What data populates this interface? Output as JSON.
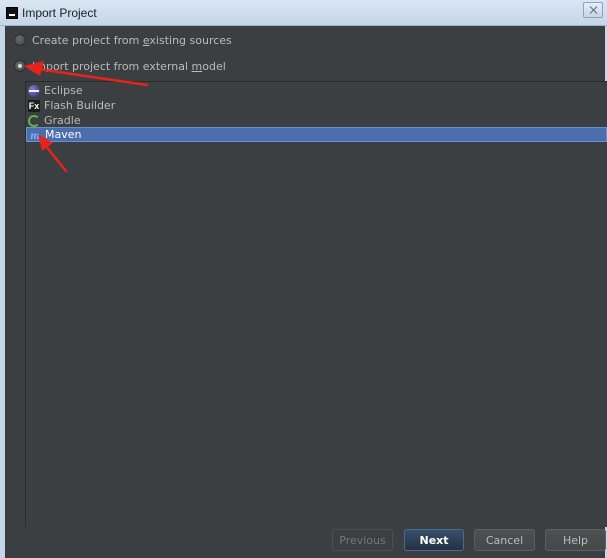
{
  "window": {
    "title": "Import Project"
  },
  "options": {
    "create": {
      "label_pre": "Create project from ",
      "label_mnemonic": "e",
      "label_post": "xisting sources",
      "selected": false
    },
    "import": {
      "label_pre": "Import project from external ",
      "label_mnemonic": "m",
      "label_post": "odel",
      "selected": true
    }
  },
  "models": [
    {
      "label": "Eclipse",
      "icon": "eclipse-icon",
      "selected": false
    },
    {
      "label": "Flash Builder",
      "icon": "flash-builder-icon",
      "icon_text": "Fx",
      "selected": false
    },
    {
      "label": "Gradle",
      "icon": "gradle-icon",
      "selected": false
    },
    {
      "label": "Maven",
      "icon": "maven-icon",
      "icon_text": "m",
      "selected": true
    }
  ],
  "buttons": {
    "previous": "Previous",
    "next": "Next",
    "cancel": "Cancel",
    "help": "Help"
  },
  "colors": {
    "background": "#3c3f41",
    "selection": "#4b6eaf",
    "annotation": "#e8231a"
  }
}
